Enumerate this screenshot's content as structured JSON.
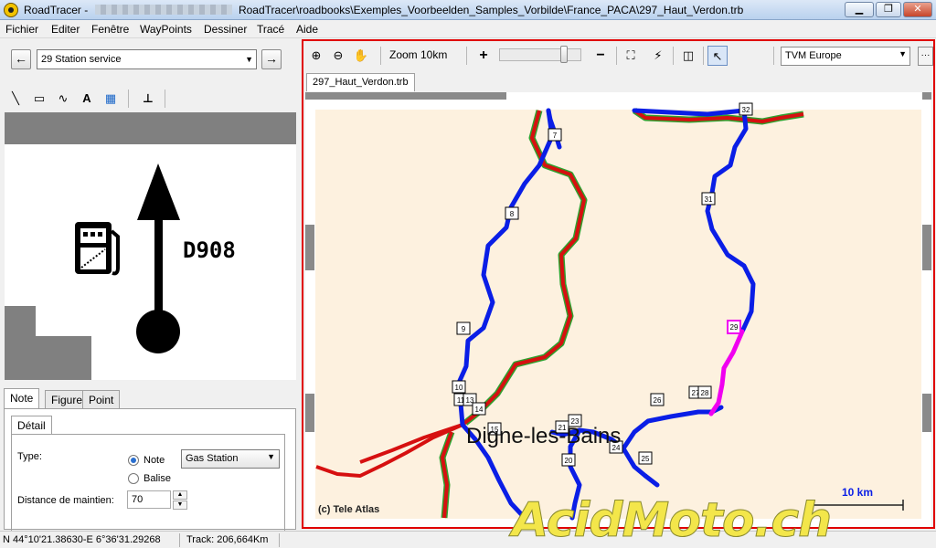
{
  "window": {
    "app_name": "RoadTracer",
    "separator": "-",
    "title_path": "RoadTracer\\roadbooks\\Exemples_Voorbeelden_Samples_Vorbilde\\France_PACA\\297_Haut_Verdon.trb",
    "minimize": "▁",
    "maximize": "❐",
    "close": "✕"
  },
  "menu": [
    "Fichier",
    "Editer",
    "Fenêtre",
    "WayPoints",
    "Dessiner",
    "Tracé",
    "Aide"
  ],
  "left": {
    "prev_icon": "arrow-left-icon",
    "prev": "←",
    "next_icon": "arrow-right-icon",
    "next": "→",
    "waypoint_select": "29 Station service",
    "draw_tools": [
      {
        "name": "line-tool-icon",
        "glyph": "╲"
      },
      {
        "name": "rectangle-tool-icon",
        "glyph": "▭"
      },
      {
        "name": "curve-tool-icon",
        "glyph": "∿"
      },
      {
        "name": "text-tool-icon",
        "glyph": "A"
      },
      {
        "name": "image-tool-icon",
        "glyph": "▦"
      },
      {
        "name": "junction-tool-icon",
        "glyph": "⊥"
      }
    ],
    "road_label": "D908",
    "tabs": [
      "Note",
      "Figure",
      "Point"
    ],
    "sub_tab": "Détail",
    "type_label": "Type:",
    "radio_note": "Note",
    "radio_balise": "Balise",
    "type_value": "Gas Station",
    "distance_label": "Distance de maintien:",
    "distance_value": "70"
  },
  "map": {
    "zoom_label": "Zoom 10km",
    "zoom_in": "+",
    "zoom_out": "−",
    "provider": "TVM Europe",
    "more": "···",
    "doc_tab": "297_Haut_Verdon.trb",
    "zoom_position": 0.82,
    "city": "Digne-les-Bains",
    "copyright": "(c) Tele Atlas",
    "scale": "10 km",
    "waypoints": [
      "32",
      "7",
      "8",
      "31",
      "9",
      "29",
      "10",
      "11",
      "13",
      "14",
      "26",
      "27",
      "28",
      "23",
      "21",
      "15",
      "24",
      "25",
      "20"
    ],
    "colors": {
      "route_blue": "#0a1ee6",
      "route_red": "#d61010",
      "route_green": "#2ea02e",
      "route_magenta": "#f000f0",
      "land": "#fdf1df",
      "frame": "#e00000"
    }
  },
  "status": {
    "coords": "N 44°10'21.38630-E 6°36'31.29268",
    "track": "Track: 206,664Km"
  },
  "watermark": "AcidMoto.ch"
}
